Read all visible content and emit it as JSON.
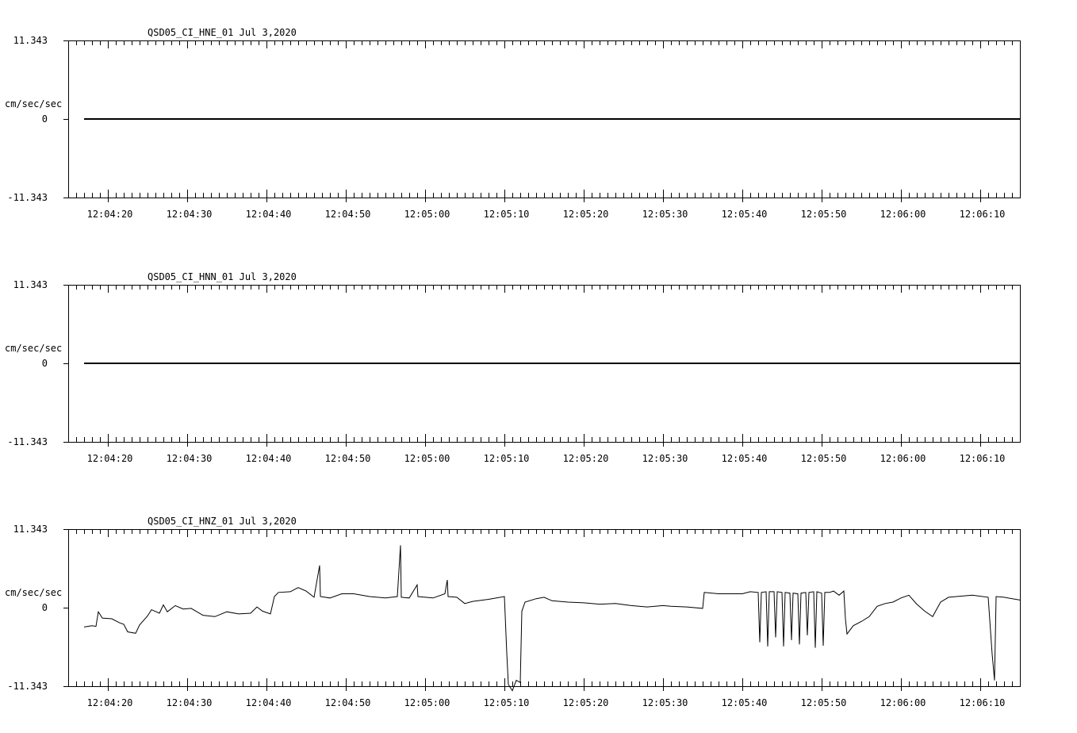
{
  "page": {
    "background": "#ffffff",
    "trace_color": "#000000"
  },
  "chart_data": [
    {
      "type": "line",
      "title": "QSD05_CI_HNE_01  Jul 3,2020",
      "ylabel": "cm/sec/sec",
      "ylim": [
        -11.343,
        11.343
      ],
      "ytick_labels": [
        "11.343",
        "0",
        "-11.343"
      ],
      "x_unit": "time",
      "xlim": [
        "12:04:15",
        "12:06:15"
      ],
      "xtick_labels": [
        "12:04:20",
        "12:04:30",
        "12:04:40",
        "12:04:50",
        "12:05:00",
        "12:05:10",
        "12:05:20",
        "12:05:30",
        "12:05:40",
        "12:05:50",
        "12:06:00",
        "12:06:10"
      ],
      "series": [
        {
          "values": [
            [
              "12:04:17",
              0
            ],
            [
              "12:06:15",
              0
            ]
          ]
        }
      ]
    },
    {
      "type": "line",
      "title": "QSD05_CI_HNN_01  Jul 3,2020",
      "ylabel": "cm/sec/sec",
      "ylim": [
        -11.343,
        11.343
      ],
      "ytick_labels": [
        "11.343",
        "0",
        "-11.343"
      ],
      "x_unit": "time",
      "xlim": [
        "12:04:15",
        "12:06:15"
      ],
      "xtick_labels": [
        "12:04:20",
        "12:04:30",
        "12:04:40",
        "12:04:50",
        "12:05:00",
        "12:05:10",
        "12:05:20",
        "12:05:30",
        "12:05:40",
        "12:05:50",
        "12:06:00",
        "12:06:10"
      ],
      "series": [
        {
          "values": [
            [
              "12:04:17",
              0
            ],
            [
              "12:06:15",
              0
            ]
          ]
        }
      ]
    },
    {
      "type": "line",
      "title": "QSD05_CI_HNZ_01  Jul 3,2020",
      "ylabel": "cm/sec/sec",
      "ylim": [
        -11.343,
        11.343
      ],
      "ytick_labels": [
        "11.343",
        "0",
        "-11.343"
      ],
      "x_unit": "time",
      "xlim": [
        "12:04:15",
        "12:06:15"
      ],
      "xtick_labels": [
        "12:04:20",
        "12:04:30",
        "12:04:40",
        "12:04:50",
        "12:05:00",
        "12:05:10",
        "12:05:20",
        "12:05:30",
        "12:05:40",
        "12:05:50",
        "12:06:00",
        "12:06:10"
      ],
      "series": [
        {
          "values": [
            [
              "12:04:17.0",
              -2.8
            ],
            [
              "12:04:18.0",
              -2.6
            ],
            [
              "12:04:18.5",
              -2.7
            ],
            [
              "12:04:18.8",
              -0.6
            ],
            [
              "12:04:19.3",
              -1.5
            ],
            [
              "12:04:20.5",
              -1.6
            ],
            [
              "12:04:21.5",
              -2.2
            ],
            [
              "12:04:22.0",
              -2.4
            ],
            [
              "12:04:22.5",
              -3.5
            ],
            [
              "12:04:23.5",
              -3.7
            ],
            [
              "12:04:24.0",
              -2.5
            ],
            [
              "12:04:25.0",
              -1.2
            ],
            [
              "12:04:25.5",
              -0.3
            ],
            [
              "12:04:26.5",
              -0.8
            ],
            [
              "12:04:27.0",
              0.4
            ],
            [
              "12:04:27.5",
              -0.6
            ],
            [
              "12:04:28.5",
              0.3
            ],
            [
              "12:04:29.5",
              -0.2
            ],
            [
              "12:04:30.5",
              -0.1
            ],
            [
              "12:04:32.0",
              -1.1
            ],
            [
              "12:04:33.5",
              -1.3
            ],
            [
              "12:04:35.0",
              -0.6
            ],
            [
              "12:04:36.5",
              -0.9
            ],
            [
              "12:04:38.0",
              -0.8
            ],
            [
              "12:04:38.8",
              0.1
            ],
            [
              "12:04:39.5",
              -0.5
            ],
            [
              "12:04:40.5",
              -0.9
            ],
            [
              "12:04:41.0",
              1.6
            ],
            [
              "12:04:41.5",
              2.2
            ],
            [
              "12:04:43.0",
              2.3
            ],
            [
              "12:04:44.0",
              2.9
            ],
            [
              "12:04:45.0",
              2.4
            ],
            [
              "12:04:46.0",
              1.5
            ],
            [
              "12:04:46.7",
              6.1
            ],
            [
              "12:04:46.8",
              1.6
            ],
            [
              "12:04:48.0",
              1.4
            ],
            [
              "12:04:49.5",
              2.0
            ],
            [
              "12:04:51.0",
              2.0
            ],
            [
              "12:04:53.0",
              1.6
            ],
            [
              "12:04:55.0",
              1.4
            ],
            [
              "12:04:56.5",
              1.6
            ],
            [
              "12:04:56.9",
              9.0
            ],
            [
              "12:04:57.0",
              1.5
            ],
            [
              "12:04:58.0",
              1.4
            ],
            [
              "12:04:59.0",
              3.3
            ],
            [
              "12:04:59.1",
              1.6
            ],
            [
              "12:05:01.0",
              1.4
            ],
            [
              "12:05:02.5",
              2.0
            ],
            [
              "12:05:02.8",
              4.0
            ],
            [
              "12:05:02.9",
              1.6
            ],
            [
              "12:05:04.0",
              1.5
            ],
            [
              "12:05:05.0",
              0.6
            ],
            [
              "12:05:06.0",
              0.9
            ],
            [
              "12:05:08.0",
              1.2
            ],
            [
              "12:05:10.0",
              1.6
            ],
            [
              "12:05:10.3",
              -6.6
            ],
            [
              "12:05:10.5",
              -11.1
            ],
            [
              "12:05:11.0",
              -12.0
            ],
            [
              "12:05:11.5",
              -10.5
            ],
            [
              "12:05:12.0",
              -10.8
            ],
            [
              "12:05:12.2",
              -0.5
            ],
            [
              "12:05:12.6",
              0.8
            ],
            [
              "12:05:14.0",
              1.3
            ],
            [
              "12:05:15.0",
              1.5
            ],
            [
              "12:05:16.0",
              1.0
            ],
            [
              "12:05:18.0",
              0.8
            ],
            [
              "12:05:20.0",
              0.7
            ],
            [
              "12:05:22.0",
              0.5
            ],
            [
              "12:05:24.0",
              0.6
            ],
            [
              "12:05:26.0",
              0.3
            ],
            [
              "12:05:28.0",
              0.1
            ],
            [
              "12:05:30.0",
              0.3
            ],
            [
              "12:05:31.0",
              0.2
            ],
            [
              "12:05:33.0",
              0.1
            ],
            [
              "12:05:35.0",
              -0.1
            ],
            [
              "12:05:35.2",
              2.2
            ],
            [
              "12:05:37.0",
              2.0
            ],
            [
              "12:05:40.0",
              2.0
            ],
            [
              "12:05:41.0",
              2.3
            ],
            [
              "12:05:42.0",
              2.2
            ],
            [
              "12:05:42.2",
              -5.0
            ],
            [
              "12:05:42.4",
              2.2
            ],
            [
              "12:05:43.0",
              2.3
            ],
            [
              "12:05:43.2",
              -5.6
            ],
            [
              "12:05:43.4",
              2.3
            ],
            [
              "12:05:44.0",
              2.3
            ],
            [
              "12:05:44.2",
              -4.3
            ],
            [
              "12:05:44.4",
              2.3
            ],
            [
              "12:05:45.0",
              2.2
            ],
            [
              "12:05:45.2",
              -5.6
            ],
            [
              "12:05:45.4",
              2.2
            ],
            [
              "12:05:46.0",
              2.1
            ],
            [
              "12:05:46.2",
              -4.7
            ],
            [
              "12:05:46.4",
              2.1
            ],
            [
              "12:05:47.0",
              2.0
            ],
            [
              "12:05:47.2",
              -5.3
            ],
            [
              "12:05:47.4",
              2.1
            ],
            [
              "12:05:48.0",
              2.2
            ],
            [
              "12:05:48.2",
              -4.0
            ],
            [
              "12:05:48.4",
              2.2
            ],
            [
              "12:05:49.0",
              2.3
            ],
            [
              "12:05:49.2",
              -5.8
            ],
            [
              "12:05:49.4",
              2.3
            ],
            [
              "12:05:50.0",
              2.1
            ],
            [
              "12:05:50.2",
              -5.5
            ],
            [
              "12:05:50.4",
              2.2
            ],
            [
              "12:05:51.0",
              2.2
            ],
            [
              "12:05:51.5",
              2.4
            ],
            [
              "12:05:52.2",
              1.8
            ],
            [
              "12:05:52.8",
              2.4
            ],
            [
              "12:05:53.0",
              -1.6
            ],
            [
              "12:05:53.2",
              -3.8
            ],
            [
              "12:05:54.0",
              -2.6
            ],
            [
              "12:05:55.0",
              -2.0
            ],
            [
              "12:05:56.0",
              -1.3
            ],
            [
              "12:05:57.0",
              0.2
            ],
            [
              "12:05:58.0",
              0.6
            ],
            [
              "12:05:59.0",
              0.8
            ],
            [
              "12:06:00.0",
              1.4
            ],
            [
              "12:06:01.0",
              1.8
            ],
            [
              "12:06:02.0",
              0.5
            ],
            [
              "12:06:03.0",
              -0.5
            ],
            [
              "12:06:04.0",
              -1.3
            ],
            [
              "12:06:05.0",
              0.8
            ],
            [
              "12:06:06.0",
              1.5
            ],
            [
              "12:06:07.0",
              1.6
            ],
            [
              "12:06:09.0",
              1.8
            ],
            [
              "12:06:11.0",
              1.5
            ],
            [
              "12:06:11.5",
              -6.7
            ],
            [
              "12:06:11.8",
              -10.5
            ],
            [
              "12:06:12.0",
              1.6
            ],
            [
              "12:06:13.0",
              1.5
            ],
            [
              "12:06:15.0",
              1.1
            ]
          ]
        }
      ]
    }
  ]
}
